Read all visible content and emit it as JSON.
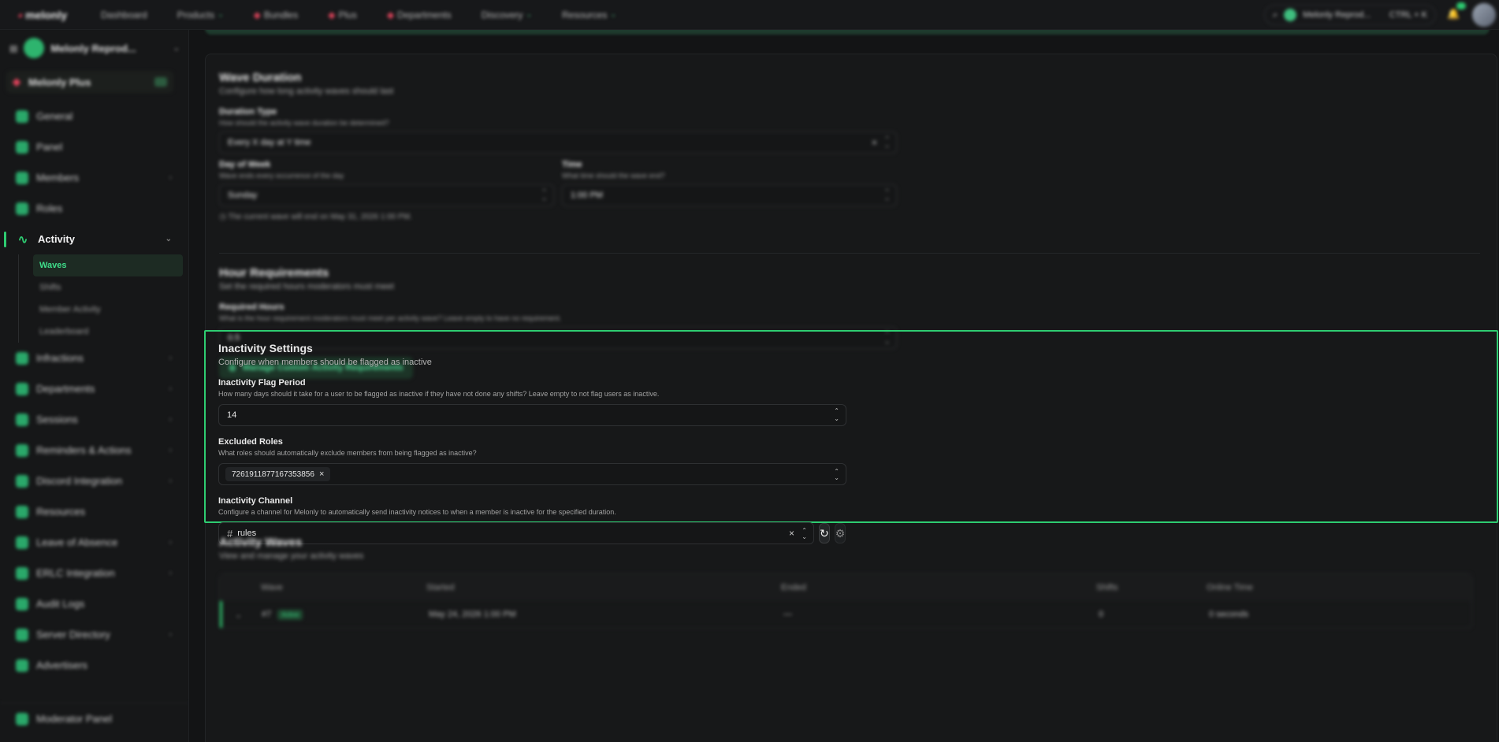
{
  "topbar": {
    "logo": "melonly",
    "nav": [
      "Dashboard",
      "Products",
      "Bundles",
      "Plus",
      "Departments",
      "Discovery",
      "Resources"
    ],
    "server_selector": "Melonly Reprod...",
    "server_shortcut": "CTRL + K"
  },
  "sidebar": {
    "server_name": "Melonly Reprod...",
    "plus_label": "Melonly Plus",
    "items": [
      {
        "label": "General",
        "icon": "globe-icon"
      },
      {
        "label": "Panel",
        "icon": "monitor-icon"
      },
      {
        "label": "Members",
        "icon": "users-icon"
      },
      {
        "label": "Roles",
        "icon": "key-icon"
      },
      {
        "label": "Activity",
        "icon": "activity-icon"
      },
      {
        "label": "Infractions",
        "icon": "gavel-icon"
      },
      {
        "label": "Departments",
        "icon": "building-icon"
      },
      {
        "label": "Sessions",
        "icon": "chart-icon"
      },
      {
        "label": "Reminders & Actions",
        "icon": "bell-icon"
      },
      {
        "label": "Discord Integration",
        "icon": "discord-icon"
      },
      {
        "label": "Resources",
        "icon": "document-icon"
      },
      {
        "label": "Leave of Absence",
        "icon": "calendar-icon"
      },
      {
        "label": "ERLC Integration",
        "icon": "link-icon"
      },
      {
        "label": "Audit Logs",
        "icon": "log-icon"
      },
      {
        "label": "Server Directory",
        "icon": "directory-icon"
      },
      {
        "label": "Advertisers",
        "icon": "megaphone-icon"
      }
    ],
    "activity_sub": [
      "Waves",
      "Shifts",
      "Member Activity",
      "Leaderboard"
    ],
    "moderator_panel": "Moderator Panel"
  },
  "wave_duration": {
    "title": "Wave Duration",
    "subtitle": "Configure how long activity waves should last",
    "duration_type_label": "Duration Type",
    "duration_type_help": "How should the activity wave duration be determined?",
    "duration_type_value": "Every X day at Y time",
    "day_label": "Day of Week",
    "day_help": "Wave ends every occurrence of the day",
    "day_value": "Sunday",
    "time_label": "Time",
    "time_help": "What time should the wave end?",
    "time_value": "1:00 PM",
    "note": "The current wave will end on May 31, 2026 1:00 PM."
  },
  "hour_requirements": {
    "title": "Hour Requirements",
    "subtitle": "Set the required hours moderators must meet",
    "required_label": "Required Hours",
    "required_help": "What is the hour requirement moderators must meet per activity wave? Leave empty to have no requirement.",
    "required_value": "0.5",
    "manage_button": "Manage Custom Activity Requirements"
  },
  "inactivity": {
    "title": "Inactivity Settings",
    "subtitle": "Configure when members should be flagged as inactive",
    "flag_label": "Inactivity Flag Period",
    "flag_help": "How many days should it take for a user to be flagged as inactive if they have not done any shifts? Leave empty to not flag users as inactive.",
    "flag_value": "14",
    "roles_label": "Excluded Roles",
    "roles_help": "What roles should automatically exclude members from being flagged as inactive?",
    "roles_chip": "7261911877167353856",
    "channel_label": "Inactivity Channel",
    "channel_help": "Configure a channel for Melonly to automatically send inactivity notices to when a member is inactive for the specified duration.",
    "channel_value": "rules"
  },
  "activity_waves": {
    "title": "Activity Waves",
    "subtitle": "View and manage your activity waves",
    "columns": [
      "Wave",
      "Started",
      "Ended",
      "Shifts",
      "Online Time"
    ],
    "row": {
      "wave": "#7",
      "status": "Active",
      "started": "May 24, 2026 1:00 PM",
      "ended": "—",
      "shifts": "0",
      "online": "0 seconds"
    }
  }
}
